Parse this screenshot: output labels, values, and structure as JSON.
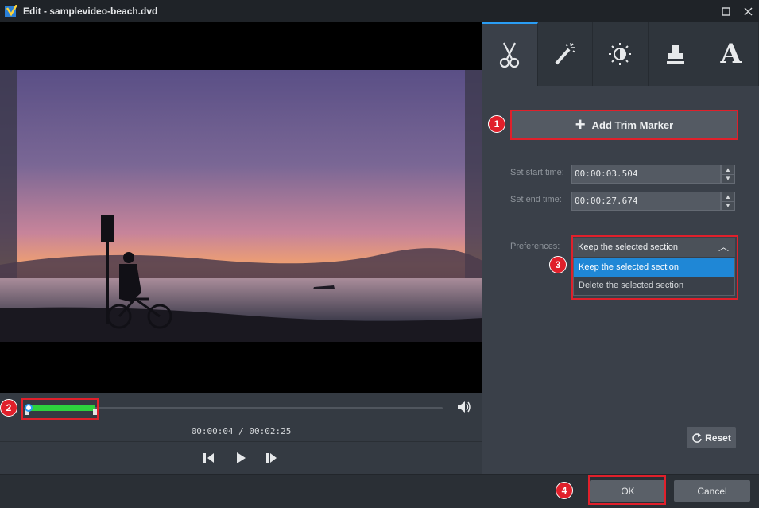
{
  "window": {
    "title": "Edit - samplevideo-beach.dvd",
    "maximize_icon": "maximize-icon",
    "close_icon": "close-icon"
  },
  "player": {
    "timecode": "00:00:04 / 00:02:25",
    "playhead_fraction": 0.0,
    "selection_start_fraction": 0.0,
    "selection_end_fraction": 0.17
  },
  "tabs": [
    {
      "name": "trim",
      "icon": "scissors-icon",
      "active": true
    },
    {
      "name": "effects",
      "icon": "magic-wand-icon",
      "active": false
    },
    {
      "name": "adjust",
      "icon": "brightness-icon",
      "active": false
    },
    {
      "name": "watermark",
      "icon": "stamp-icon",
      "active": false
    },
    {
      "name": "text",
      "label": "A",
      "icon": "text-icon",
      "active": false
    }
  ],
  "trim": {
    "add_marker_label": "Add Trim Marker",
    "start_label": "Set start time:",
    "start_value": "00:00:03.504",
    "end_label": "Set end time:",
    "end_value": "00:00:27.674",
    "pref_label": "Preferences:",
    "pref_selected": "Keep the selected section",
    "pref_options": [
      "Keep the selected section",
      "Delete the selected section"
    ],
    "reset_label": "Reset"
  },
  "footer": {
    "ok_label": "OK",
    "cancel_label": "Cancel"
  },
  "annotations": [
    "1",
    "2",
    "3",
    "4"
  ],
  "colors": {
    "accent": "#2a9df4",
    "selection": "#2dd23e",
    "highlight": "#e0202b",
    "dropdown_selected": "#1f87d6"
  }
}
